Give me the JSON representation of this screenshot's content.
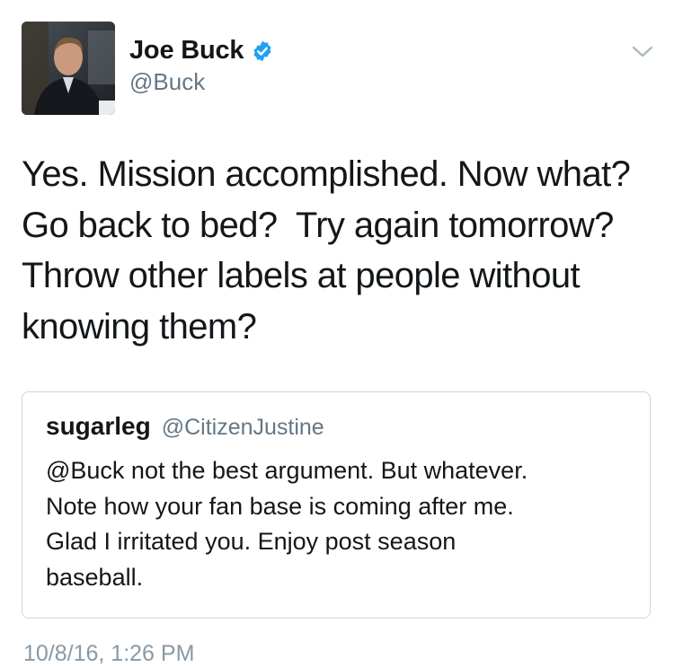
{
  "author": {
    "display_name": "Joe Buck",
    "handle": "@Buck",
    "verified": true
  },
  "tweet": {
    "lines": [
      "Yes. Mission accomplished. Now what?",
      "Go back to bed?  Try again tomorrow?",
      "Throw other labels at people without",
      "knowing them?"
    ],
    "timestamp": "10/8/16, 1:26 PM"
  },
  "quoted_tweet": {
    "display_name": "sugarleg",
    "handle": "@CitizenJustine",
    "lines": [
      "@Buck not the best argument. But whatever.",
      "Note how your fan base is coming after me.",
      "Glad I irritated you. Enjoy post season",
      "baseball."
    ]
  },
  "icons": {
    "verified": "verified-badge-icon",
    "menu": "chevron-down-icon"
  },
  "colors": {
    "verified_blue": "#1da1f2",
    "secondary_text": "#657786",
    "border": "#ccd6dd"
  }
}
